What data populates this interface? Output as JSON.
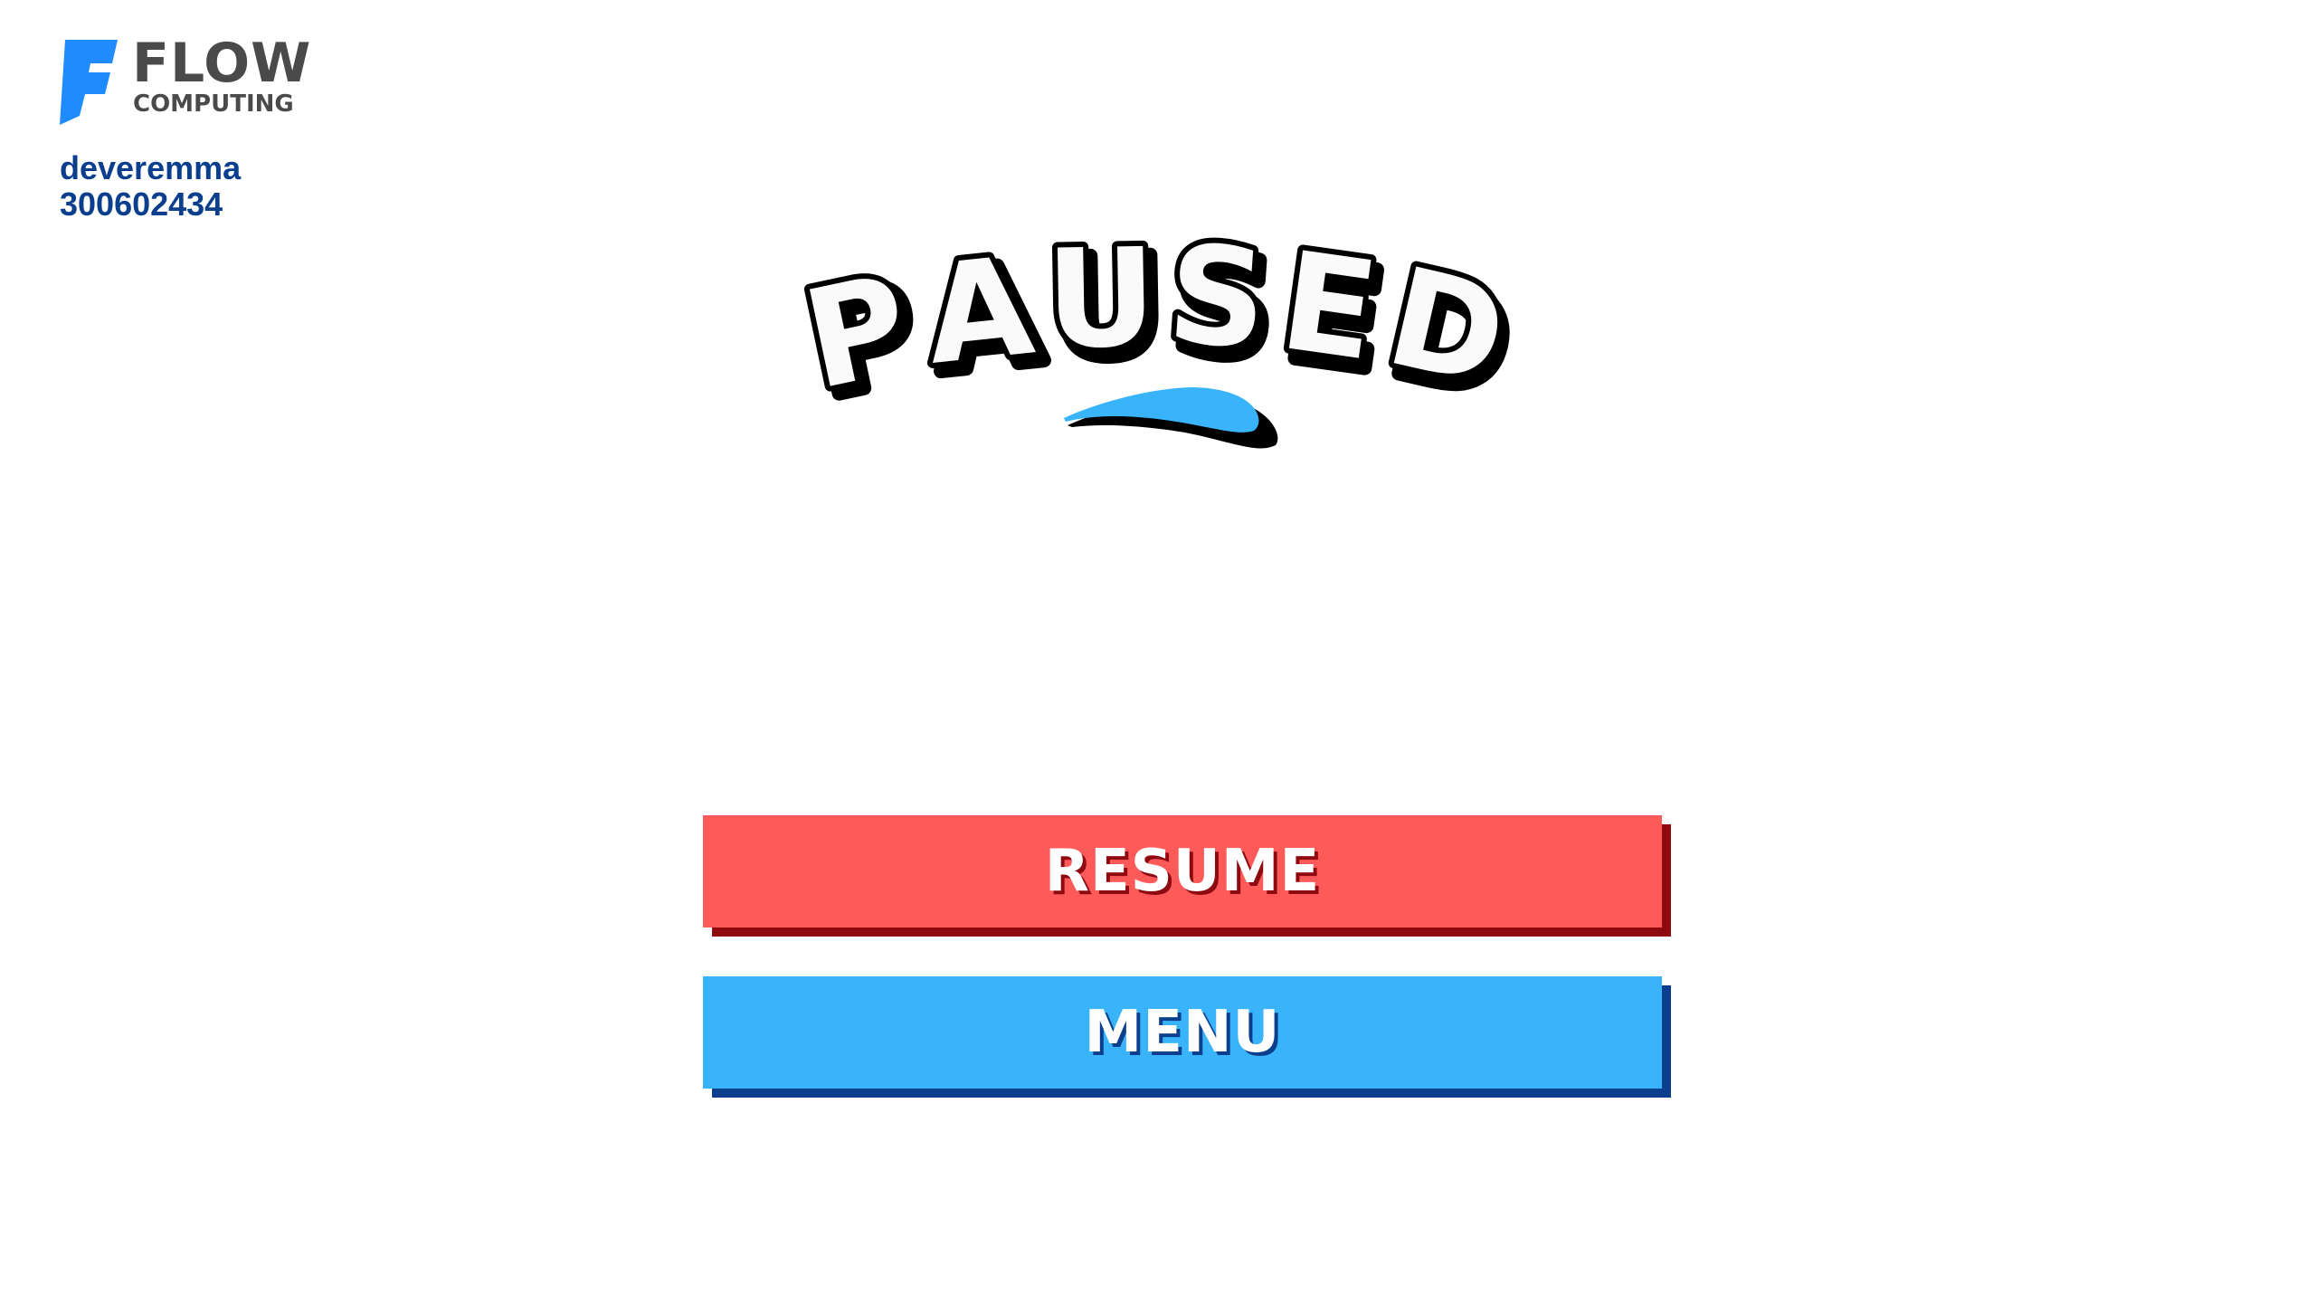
{
  "brand": {
    "name": "FLOW",
    "subtitle": "COMPUTING",
    "logo_icon": "flow-f-logo-icon",
    "logo_color": "#1f8bff"
  },
  "player": {
    "username": "deveremma",
    "id": "300602434"
  },
  "pause_screen": {
    "title": "PAUSED",
    "title_letters": [
      "P",
      "A",
      "U",
      "S",
      "E",
      "D"
    ],
    "swoosh_icon": "swoosh-underline-icon",
    "accent_color": "#39b4fb"
  },
  "buttons": {
    "resume_label": "RESUME",
    "resume_color": "#ff5a5a",
    "resume_shadow_color": "#8e0a10",
    "menu_label": "MENU",
    "menu_color": "#39b4fb",
    "menu_shadow_color": "#0b3f8e"
  }
}
